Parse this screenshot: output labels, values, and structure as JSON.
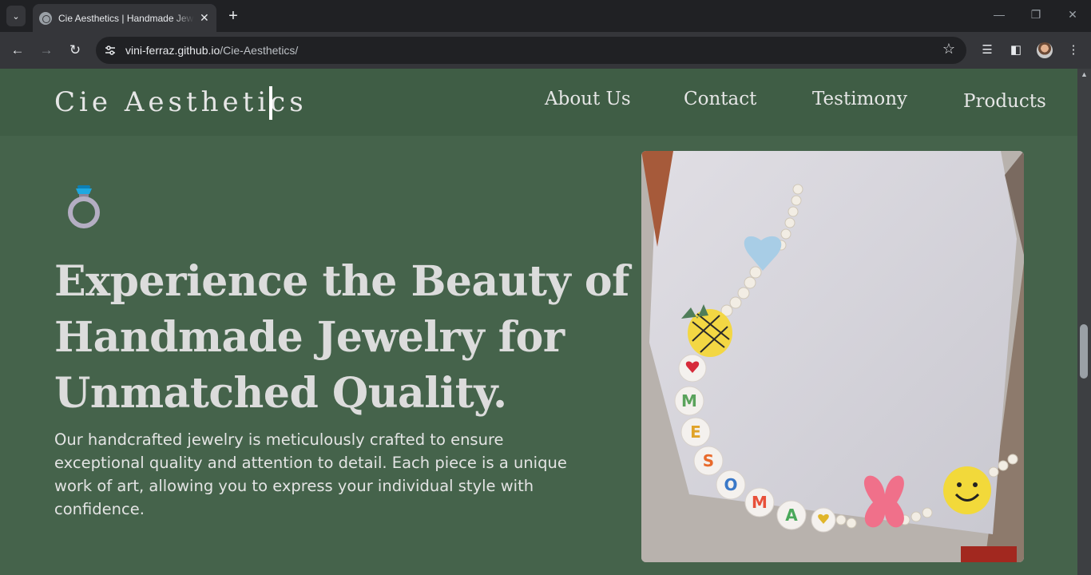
{
  "browser": {
    "tab_title": "Cie Aesthetics | Handmade Jewelry",
    "url_host": "vini-ferraz.github.io",
    "url_path": "/Cie-Aesthetics/"
  },
  "site": {
    "logo": "Cie Aesthetics",
    "nav": [
      "About Us",
      "Contact",
      "Testimony",
      "Products"
    ]
  },
  "hero": {
    "headline": [
      "Experience the Beauty of",
      "Handmade Jewelry for",
      "Unmatched Quality."
    ],
    "description": "Our handcrafted jewelry is meticulously crafted to ensure exceptional quality and attention to detail. Each piece is a unique work of art, allowing you to express your individual style with confidence.",
    "bead_letters": [
      "M",
      "E",
      "S",
      "O",
      "M",
      "A"
    ]
  },
  "colors": {
    "page_bg": "#45634b",
    "header_bg": "#3f5d45",
    "text": "#e4e4e4",
    "ring_gem": "#1fa8e0",
    "ring_band": "#b4aec3"
  }
}
